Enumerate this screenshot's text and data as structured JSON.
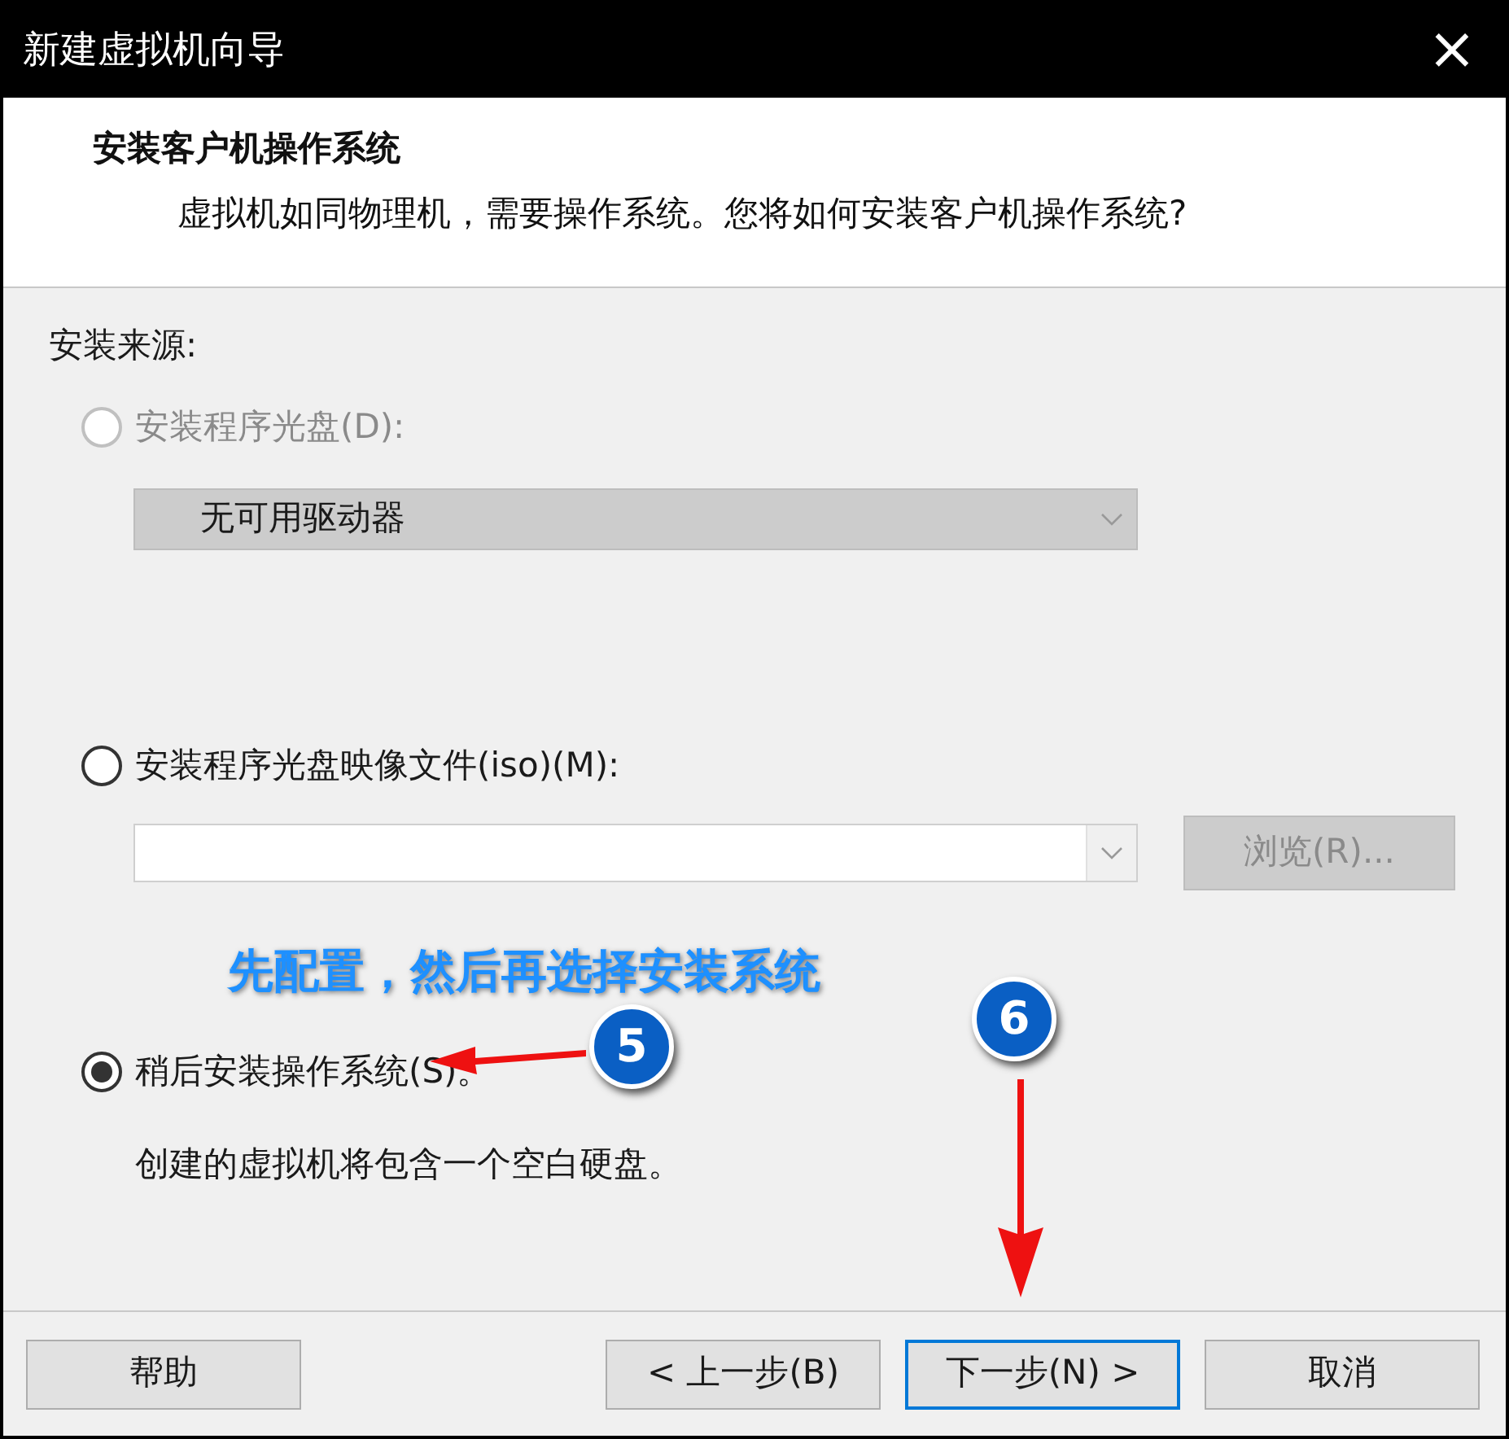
{
  "window": {
    "title": "新建虚拟机向导",
    "close": "×"
  },
  "header": {
    "heading": "安装客户机操作系统",
    "subtitle": "虚拟机如同物理机，需要操作系统。您将如何安装客户机操作系统?"
  },
  "source_label": "安装来源:",
  "options": [
    {
      "kind": "disc",
      "label": "安装程序光盘(D):",
      "selected": false,
      "disabled": true,
      "dropdown": {
        "value": "无可用驱动器",
        "disabled": true
      }
    },
    {
      "kind": "iso",
      "label": "安装程序光盘映像文件(iso)(M):",
      "selected": false,
      "disabled": false,
      "browse": {
        "label": "浏览(R)...",
        "disabled": true
      }
    },
    {
      "kind": "later",
      "label": "稍后安装操作系统(S)。",
      "selected": true,
      "disabled": false,
      "description": "创建的虚拟机将包含一个空白硬盘。"
    }
  ],
  "buttons": [
    {
      "label": "帮助",
      "default": false
    },
    {
      "label": "< 上一步(B)",
      "default": false
    },
    {
      "label": "下一步(N) >",
      "default": true
    },
    {
      "label": "取消",
      "default": false
    }
  ],
  "annotations": {
    "note": "先配置，然后再选择安装系统",
    "markers": [
      "5",
      "6"
    ]
  }
}
